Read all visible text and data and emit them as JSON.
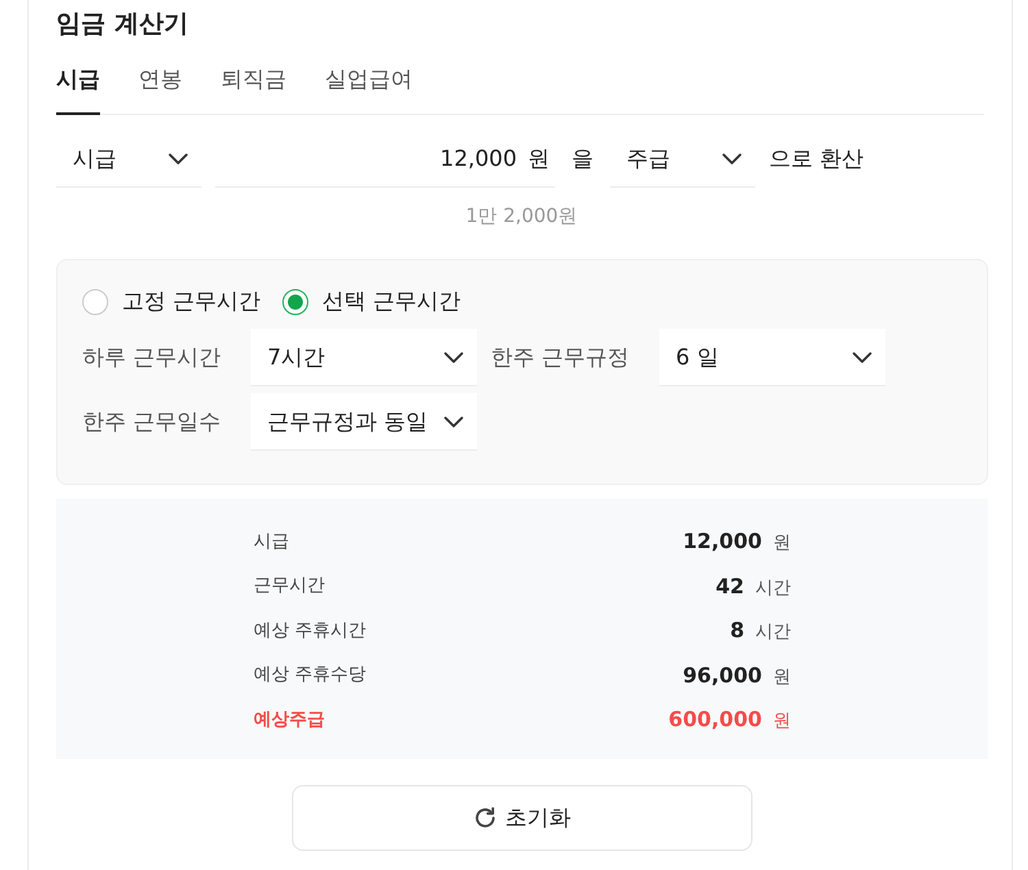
{
  "title": "임금 계산기",
  "tabs": [
    {
      "label": "시급",
      "selected": true
    },
    {
      "label": "연봉",
      "selected": false
    },
    {
      "label": "퇴직금",
      "selected": false
    },
    {
      "label": "실업급여",
      "selected": false
    }
  ],
  "converter": {
    "from_unit": "시급",
    "amount": "12,000",
    "amount_unit": "원",
    "particle": "을",
    "to_unit": "주급",
    "suffix": "으로 환산",
    "amount_in_words": "1만 2,000원"
  },
  "work_time": {
    "options": [
      {
        "label": "고정 근무시간",
        "selected": false
      },
      {
        "label": "선택 근무시간",
        "selected": true
      }
    ],
    "fields": [
      {
        "label": "하루 근무시간",
        "value": "7시간"
      },
      {
        "label": "한주 근무규정",
        "value": "6 일"
      },
      {
        "label": "한주 근무일수",
        "value": "근무규정과 동일"
      }
    ]
  },
  "results": [
    {
      "label": "시급",
      "value": "12,000",
      "unit": "원",
      "highlight": false
    },
    {
      "label": "근무시간",
      "value": "42",
      "unit": "시간",
      "highlight": false
    },
    {
      "label": "예상 주휴시간",
      "value": "8",
      "unit": "시간",
      "highlight": false
    },
    {
      "label": "예상 주휴수당",
      "value": "96,000",
      "unit": "원",
      "highlight": false
    },
    {
      "label": "예상주급",
      "value": "600,000",
      "unit": "원",
      "highlight": true
    }
  ],
  "reset_button": "초기화"
}
